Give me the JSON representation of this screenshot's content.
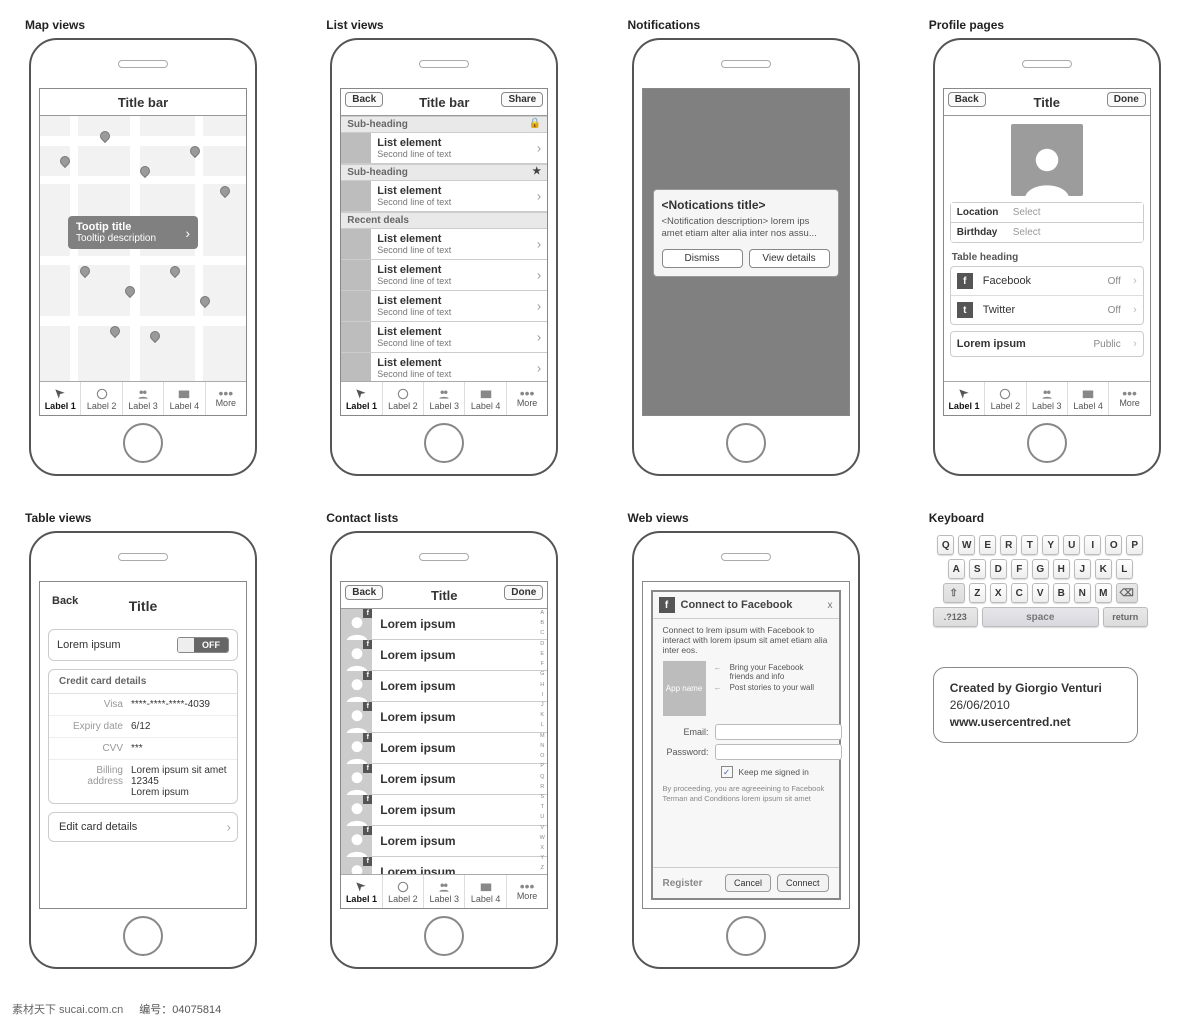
{
  "sections": [
    "Map views",
    "List views",
    "Notifications",
    "Profile pages",
    "Table views",
    "Contact lists",
    "Web views",
    "Keyboard"
  ],
  "tabs": {
    "items": [
      "Label 1",
      "Label 2",
      "Label 3",
      "Label 4",
      "More"
    ]
  },
  "map": {
    "titlebar": "Title bar",
    "tooltip_title": "Tootip title",
    "tooltip_desc": "Tooltip description"
  },
  "list": {
    "titlebar": "Title bar",
    "back": "Back",
    "share": "Share",
    "sub1": "Sub-heading",
    "sub2": "Sub-heading",
    "sub3": "Recent deals",
    "item_title": "List element",
    "item_sub": "Second line of text"
  },
  "notif": {
    "title": "<Notications title>",
    "desc": "<Notification description> lorem ips amet etiam alter alia inter nos assu...",
    "dismiss": "Dismiss",
    "view": "View details"
  },
  "profile": {
    "back": "Back",
    "title": "Title",
    "done": "Done",
    "location": "Location",
    "birthday": "Birthday",
    "select": "Select",
    "table_heading": "Table heading",
    "facebook": "Facebook",
    "twitter": "Twitter",
    "off": "Off",
    "lorem": "Lorem ipsum",
    "public": "Public"
  },
  "table": {
    "back": "Back",
    "title": "Title",
    "lorem": "Lorem ipsum",
    "toggle_on": "",
    "toggle_off": "OFF",
    "cc_head": "Credit card details",
    "visa_label": "Visa",
    "visa_val": "****-****-****-4039",
    "exp_label": "Expiry date",
    "exp_val": "6/12",
    "cvv_label": "CVV",
    "cvv_val": "***",
    "addr_label": "Billing address",
    "addr_val": "Lorem ipsum sit amet\n12345\nLorem ipsum",
    "edit": "Edit card details"
  },
  "contacts": {
    "back": "Back",
    "title": "Title",
    "done": "Done",
    "name": "Lorem ipsum",
    "az": [
      "A",
      "B",
      "C",
      "D",
      "E",
      "F",
      "G",
      "H",
      "I",
      "J",
      "K",
      "L",
      "M",
      "N",
      "O",
      "P",
      "Q",
      "R",
      "S",
      "T",
      "U",
      "V",
      "W",
      "X",
      "Y",
      "Z"
    ]
  },
  "web": {
    "head": "Connect to Facebook",
    "intro": "Connect to lrem ipsum with Facebook to interact with lorem ipsum sit amet etiam alia inter eos.",
    "appname": "App name",
    "note1": "Bring your Facebook friends and info",
    "note2": "Post stories to your wall",
    "email": "Email:",
    "password": "Password:",
    "keep": "Keep me signed in",
    "disclaimer": "By proceeding, you are agreeeining to Facebook Terman and Conditions lorem ipsum sit amet",
    "register": "Register",
    "cancel": "Cancel",
    "connect": "Connect"
  },
  "keyboard": {
    "row1": [
      "Q",
      "W",
      "E",
      "R",
      "T",
      "Y",
      "U",
      "I",
      "O",
      "P"
    ],
    "row2": [
      "A",
      "S",
      "D",
      "F",
      "G",
      "H",
      "J",
      "K",
      "L"
    ],
    "row3": [
      "Z",
      "X",
      "C",
      "V",
      "B",
      "N",
      "M"
    ],
    "shift": "⇧",
    "bksp": "⌫",
    "sym": ".?123",
    "space": "space",
    "return": "return"
  },
  "credit": {
    "line1": "Created by Giorgio Venturi",
    "line2": "26/06/2010",
    "line3": "www.usercentred.net"
  },
  "watermark": {
    "cn": "素材天下  sucai.com.cn",
    "id_label": "编号：",
    "id_val": "04075814"
  }
}
